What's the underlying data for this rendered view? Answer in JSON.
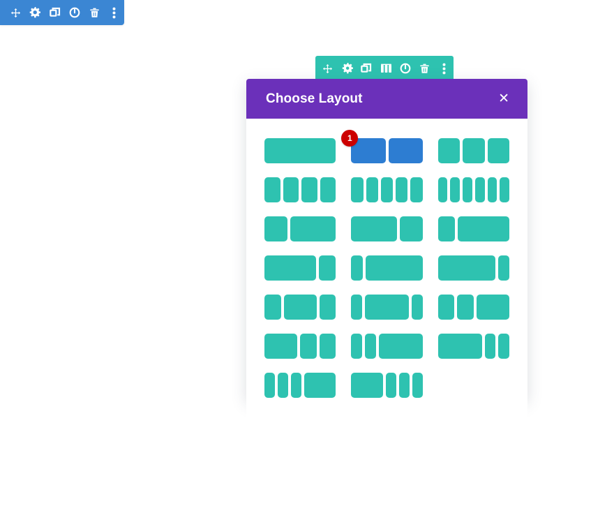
{
  "blue_toolbar": {
    "name": "section-settings-toolbar",
    "background": "#3b86d3",
    "buttons": [
      {
        "icon": "move-icon",
        "label": "Move"
      },
      {
        "icon": "gear-icon",
        "label": "Settings"
      },
      {
        "icon": "duplicate-icon",
        "label": "Duplicate"
      },
      {
        "icon": "power-icon",
        "label": "Disable"
      },
      {
        "icon": "trash-icon",
        "label": "Delete"
      },
      {
        "icon": "dots-vertical-icon",
        "label": "More Options"
      }
    ]
  },
  "teal_toolbar": {
    "name": "row-settings-toolbar",
    "background": "#2ec2b0",
    "buttons": [
      {
        "icon": "move-icon",
        "label": "Move",
        "active": false
      },
      {
        "icon": "gear-icon",
        "label": "Settings",
        "active": false
      },
      {
        "icon": "duplicate-icon",
        "label": "Duplicate",
        "active": false
      },
      {
        "icon": "columns-icon",
        "label": "Change Structure",
        "active": true
      },
      {
        "icon": "power-icon",
        "label": "Disable",
        "active": false
      },
      {
        "icon": "trash-icon",
        "label": "Delete",
        "active": false
      },
      {
        "icon": "dots-vertical-icon",
        "label": "More Options",
        "active": false
      }
    ]
  },
  "modal": {
    "title": "Choose Layout",
    "close_label": "✕",
    "header_color": "#6b30ba",
    "accent_color": "#2ec2b0",
    "selected_color": "#2d7dd2",
    "badge_color": "#cc0000",
    "layouts": [
      {
        "name": "layout-1-column",
        "columns": [
          12
        ],
        "selected": false,
        "badge": null
      },
      {
        "name": "layout-2-columns-equal",
        "columns": [
          6,
          6
        ],
        "selected": true,
        "badge": "1"
      },
      {
        "name": "layout-3-columns-equal",
        "columns": [
          4,
          4,
          4
        ],
        "selected": false,
        "badge": null
      },
      {
        "name": "layout-4-columns-equal",
        "columns": [
          3,
          3,
          3,
          3
        ],
        "selected": false,
        "badge": null
      },
      {
        "name": "layout-5-columns-equal",
        "columns": [
          2.4,
          2.4,
          2.4,
          2.4,
          2.4
        ],
        "selected": false,
        "badge": null
      },
      {
        "name": "layout-6-columns-equal",
        "columns": [
          2,
          2,
          2,
          2,
          2,
          2
        ],
        "selected": false,
        "badge": null
      },
      {
        "name": "layout-2-columns-one-third-two-thirds",
        "columns": [
          4,
          8
        ],
        "selected": false,
        "badge": null
      },
      {
        "name": "layout-2-columns-two-thirds-one-third",
        "columns": [
          8,
          4
        ],
        "selected": false,
        "badge": null
      },
      {
        "name": "layout-2-columns-one-fourth-three-fourths",
        "columns": [
          3,
          9
        ],
        "selected": false,
        "badge": null
      },
      {
        "name": "layout-2-columns-three-fourths-one-fourth",
        "columns": [
          9,
          3
        ],
        "selected": false,
        "badge": null
      },
      {
        "name": "layout-2-columns-one-sixth-five-sixths",
        "columns": [
          2,
          10
        ],
        "selected": false,
        "badge": null
      },
      {
        "name": "layout-2-columns-five-sixths-one-sixth",
        "columns": [
          10,
          2
        ],
        "selected": false,
        "badge": null
      },
      {
        "name": "layout-3-columns-narrow-wide-narrow",
        "columns": [
          3,
          6,
          3
        ],
        "selected": false,
        "badge": null
      },
      {
        "name": "layout-3-columns-small-wide-small",
        "columns": [
          2,
          8,
          2
        ],
        "selected": false,
        "badge": null
      },
      {
        "name": "layout-3-columns-narrow-narrow-wide",
        "columns": [
          3,
          3,
          6
        ],
        "selected": false,
        "badge": null
      },
      {
        "name": "layout-3-columns-wide-narrow-narrow",
        "columns": [
          6,
          3,
          3
        ],
        "selected": false,
        "badge": null
      },
      {
        "name": "layout-3-columns-small-small-wide",
        "columns": [
          2,
          2,
          8
        ],
        "selected": false,
        "badge": null
      },
      {
        "name": "layout-3-columns-wide-small-small",
        "columns": [
          8,
          2,
          2
        ],
        "selected": false,
        "badge": null
      },
      {
        "name": "layout-4-columns-three-narrow-one-wide",
        "columns": [
          2,
          2,
          2,
          6
        ],
        "selected": false,
        "badge": null
      },
      {
        "name": "layout-4-columns-one-wide-three-narrow",
        "columns": [
          6,
          2,
          2,
          2
        ],
        "selected": false,
        "badge": null
      },
      {
        "name": "layout-empty-slot",
        "columns": [],
        "selected": false,
        "badge": null
      }
    ]
  }
}
